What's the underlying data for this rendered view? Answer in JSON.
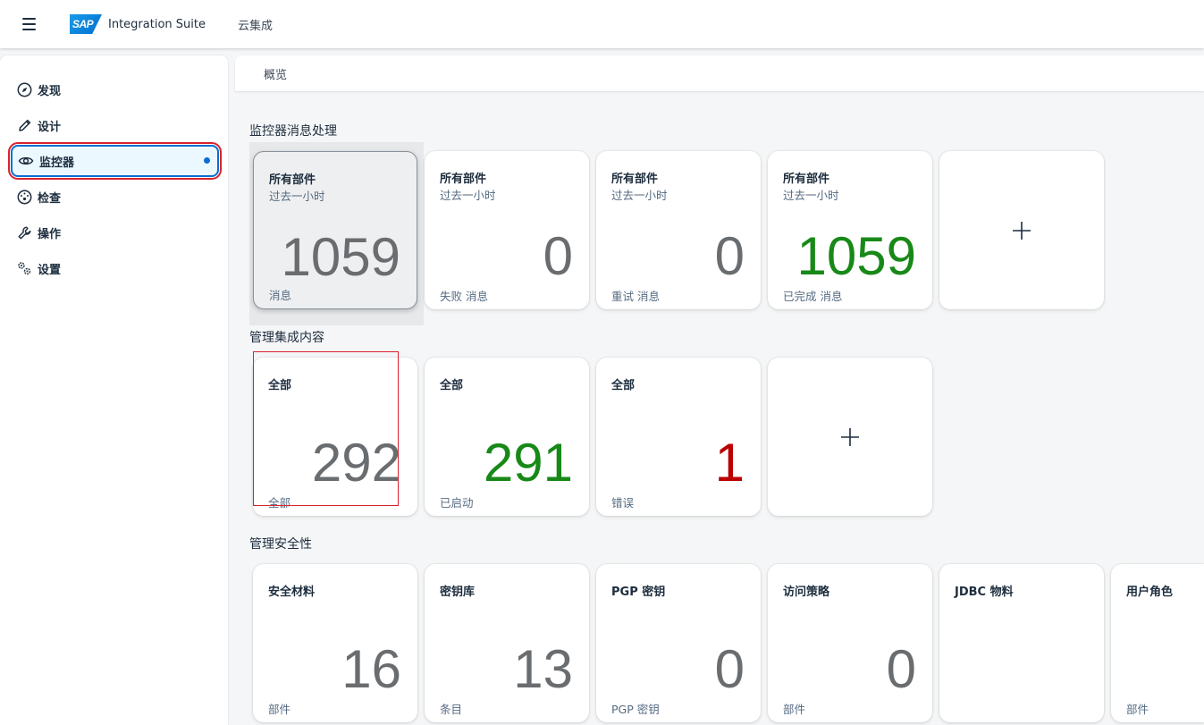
{
  "shell": {
    "logo_text": "SAP",
    "product": "Integration Suite",
    "subtitle": "云集成"
  },
  "sidebar": {
    "items": [
      {
        "label": "发现",
        "icon": "compass-icon"
      },
      {
        "label": "设计",
        "icon": "pencil-icon"
      },
      {
        "label": "监控器",
        "icon": "eye-icon",
        "selected": true
      },
      {
        "label": "检查",
        "icon": "gauge-icon"
      },
      {
        "label": "操作",
        "icon": "wrench-icon"
      },
      {
        "label": "设置",
        "icon": "gears-icon"
      }
    ]
  },
  "breadcrumb": {
    "current": "概览"
  },
  "sections": {
    "messages": {
      "title": "监控器消息处理",
      "tiles": [
        {
          "title": "所有部件",
          "subtitle": "过去一小时",
          "value": "1059",
          "footer": "消息",
          "color": "#6a6d70"
        },
        {
          "title": "所有部件",
          "subtitle": "过去一小时",
          "value": "0",
          "footer": "失败 消息",
          "color": "#6a6d70"
        },
        {
          "title": "所有部件",
          "subtitle": "过去一小时",
          "value": "0",
          "footer": "重试 消息",
          "color": "#6a6d70"
        },
        {
          "title": "所有部件",
          "subtitle": "过去一小时",
          "value": "1059",
          "footer": "已完成 消息",
          "color": "#188918"
        }
      ],
      "add_label": "+"
    },
    "content": {
      "title": "管理集成内容",
      "tiles": [
        {
          "title": "全部",
          "value": "292",
          "footer": "全部",
          "color": "#6a6d70"
        },
        {
          "title": "全部",
          "value": "291",
          "footer": "已启动",
          "color": "#188918"
        },
        {
          "title": "全部",
          "value": "1",
          "footer": "错误",
          "color": "#bb0000"
        }
      ],
      "add_label": "+"
    },
    "security": {
      "title": "管理安全性",
      "tiles": [
        {
          "title": "安全材料",
          "value": "16",
          "footer": "部件"
        },
        {
          "title": "密钥库",
          "value": "13",
          "footer": "条目"
        },
        {
          "title": "PGP 密钥",
          "value": "0",
          "footer": "PGP 密钥"
        },
        {
          "title": "访问策略",
          "value": "0",
          "footer": "部件"
        },
        {
          "title": "JDBC 物料",
          "value": "",
          "footer": ""
        },
        {
          "title": "用户角色",
          "value": "",
          "footer": "部件"
        }
      ]
    }
  }
}
